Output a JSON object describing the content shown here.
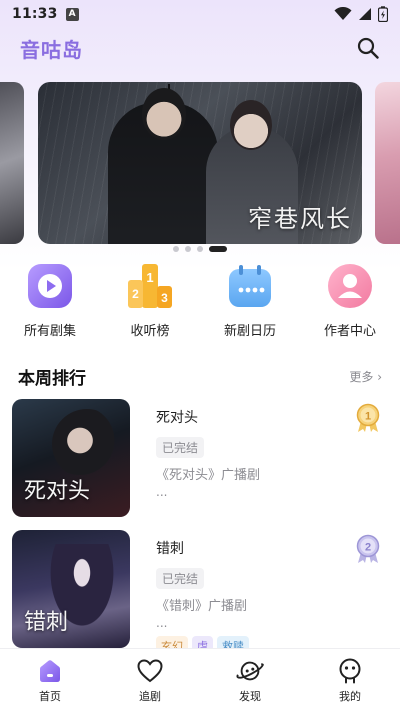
{
  "status_bar": {
    "time": "11:33",
    "notification_letter": "A"
  },
  "header": {
    "title": "音咕岛"
  },
  "banner": {
    "title_calligraphy": "窄巷风长",
    "dots_count": 4,
    "active_dot": 4
  },
  "quick_nav": [
    {
      "label": "所有剧集",
      "icon": "play-icon"
    },
    {
      "label": "收听榜",
      "icon": "podium-icon"
    },
    {
      "label": "新剧日历",
      "icon": "calendar-icon"
    },
    {
      "label": "作者中心",
      "icon": "person-icon"
    }
  ],
  "weekly_rank": {
    "title": "本周排行",
    "more": "更多 ›",
    "items": [
      {
        "rank": "1",
        "name": "死对头",
        "status": "已完结",
        "desc": "《死对头》广播剧",
        "ellipsis": "...",
        "cover_text": "死\n对头",
        "tags": []
      },
      {
        "rank": "2",
        "name": "错刺",
        "status": "已完结",
        "desc": "《错刺》广播剧",
        "ellipsis": "...",
        "cover_text": "错\n刺",
        "tags": [
          "玄幻",
          "虐",
          "救赎"
        ]
      }
    ]
  },
  "bottom_nav": [
    {
      "label": "首页",
      "icon": "home-icon",
      "active": true
    },
    {
      "label": "追剧",
      "icon": "heart-icon",
      "active": false
    },
    {
      "label": "发现",
      "icon": "planet-icon",
      "active": false
    },
    {
      "label": "我的",
      "icon": "profile-icon",
      "active": false
    }
  ],
  "colors": {
    "accent": "#8a6ee0",
    "medal_gold": "#e8b84a",
    "medal_silver": "#a9a4d8"
  }
}
